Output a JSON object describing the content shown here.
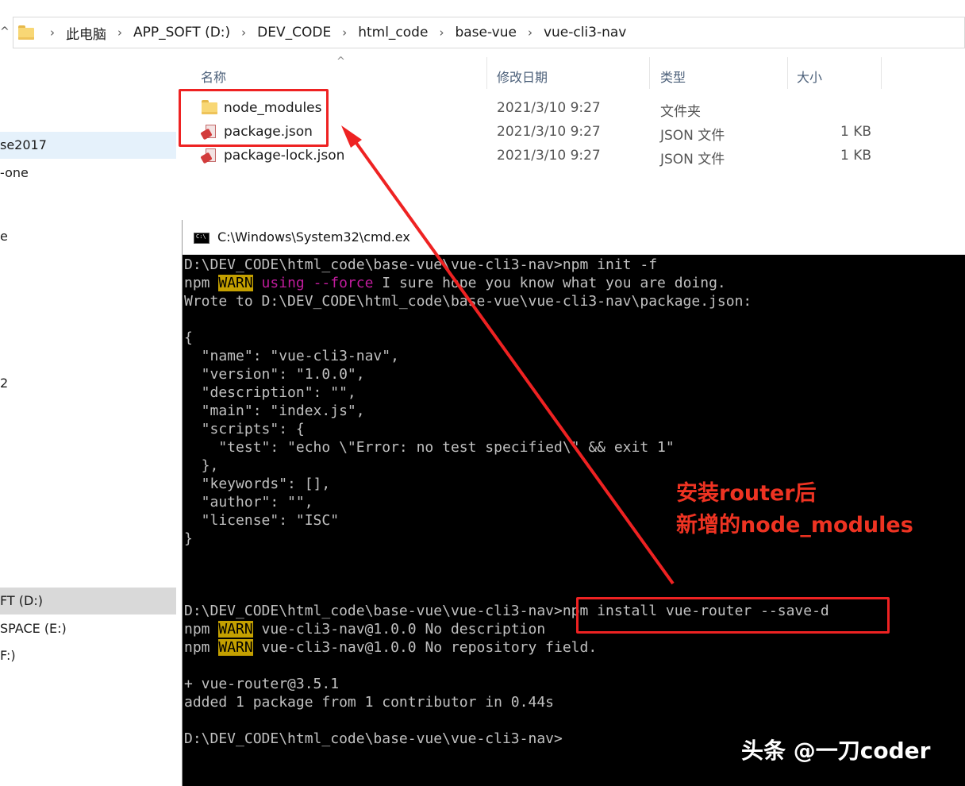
{
  "explorer": {
    "breadcrumb": [
      "此电脑",
      "APP_SOFT (D:)",
      "DEV_CODE",
      "html_code",
      "base-vue",
      "vue-cli3-nav"
    ],
    "nav_items": [
      "se2017",
      "-one",
      "e",
      "2",
      "FT (D:)",
      "SPACE (E:)",
      "F:)"
    ],
    "columns": {
      "name": "名称",
      "date": "修改日期",
      "type": "类型",
      "size": "大小"
    },
    "files": [
      {
        "name": "node_modules",
        "date": "2021/3/10 9:27",
        "type": "文件夹",
        "size": "",
        "icon": "folder-icon"
      },
      {
        "name": "package.json",
        "date": "2021/3/10 9:27",
        "type": "JSON 文件",
        "size": "1 KB",
        "icon": "json-file-icon"
      },
      {
        "name": "package-lock.json",
        "date": "2021/3/10 9:27",
        "type": "JSON 文件",
        "size": "1 KB",
        "icon": "json-file-icon"
      }
    ]
  },
  "cmd": {
    "title": "C:\\Windows\\System32\\cmd.ex",
    "lines": {
      "l1": "D:\\DEV_CODE\\html_code\\base-vue\\vue-cli3-nav>npm init -f",
      "l2_npm": "npm ",
      "l2_warn": "WARN",
      "l2_using": " using --force",
      "l2_rest": " I sure hope you know what you are doing.",
      "l3": "Wrote to D:\\DEV_CODE\\html_code\\base-vue\\vue-cli3-nav\\package.json:",
      "j1": "{",
      "j2": "  \"name\": \"vue-cli3-nav\",",
      "j3": "  \"version\": \"1.0.0\",",
      "j4": "  \"description\": \"\",",
      "j5": "  \"main\": \"index.js\",",
      "j6": "  \"scripts\": {",
      "j7": "    \"test\": \"echo \\\"Error: no test specified\\\" && exit 1\"",
      "j8": "  },",
      "j9": "  \"keywords\": [],",
      "j10": "  \"author\": \"\",",
      "j11": "  \"license\": \"ISC\"",
      "j12": "}",
      "i1": "D:\\DEV_CODE\\html_code\\base-vue\\vue-cli3-nav>npm install vue-router --save-d",
      "w1_rest": " vue-cli3-nav@1.0.0 No description",
      "w2_rest": " vue-cli3-nav@1.0.0 No repository field.",
      "r1": "+ vue-router@3.5.1",
      "r2": "added 1 package from 1 contributor in 0.44s",
      "p1": "D:\\DEV_CODE\\html_code\\base-vue\\vue-cli3-nav>"
    }
  },
  "annotation": {
    "line1": "安装router后",
    "line2": "新增的node_modules"
  },
  "watermark": "头条 @一刀coder",
  "colors": {
    "annotation_red": "#ee2222",
    "warn_bg": "#c4a000",
    "magenta": "#c01c9c"
  }
}
